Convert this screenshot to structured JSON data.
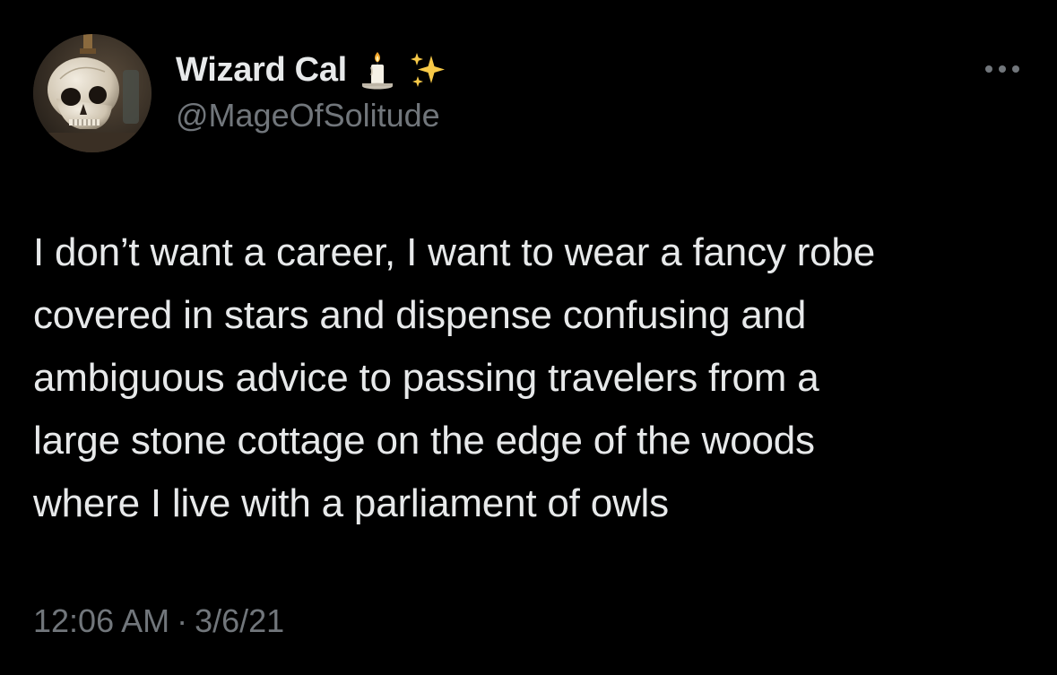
{
  "author": {
    "display_name": "Wizard Cal",
    "handle": "@MageOfSolitude",
    "name_emojis": [
      "candle-icon",
      "sparkles-icon"
    ]
  },
  "more_options_icon": "ellipsis-icon",
  "tweet": {
    "text_lines": [
      "I don’t want a career, I want to wear a fancy robe",
      "covered in stars and dispense confusing and",
      "ambiguous advice to passing travelers from a",
      "large stone cottage on the edge of the woods",
      "where I live with a parliament of owls"
    ],
    "time": "12:06 AM",
    "separator": "·",
    "date": "3/6/21"
  },
  "colors": {
    "background": "#000000",
    "primary_text": "#e7e9ea",
    "secondary_text": "#71767b",
    "sparkle": "#f7c948"
  }
}
